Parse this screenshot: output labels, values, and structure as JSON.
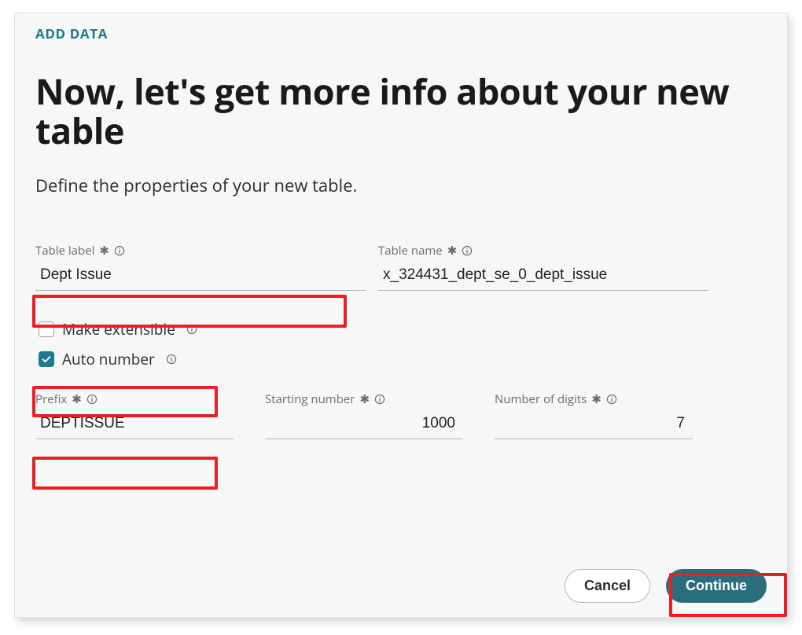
{
  "breadcrumb": "ADD DATA",
  "title": "Now, let's get more info about your new table",
  "subtitle": "Define the properties of your new table.",
  "fields": {
    "table_label": {
      "label": "Table label",
      "value": "Dept Issue"
    },
    "table_name": {
      "label": "Table name",
      "value": "x_324431_dept_se_0_dept_issue"
    },
    "make_extensible": {
      "label": "Make extensible",
      "checked": false
    },
    "auto_number": {
      "label": "Auto number",
      "checked": true
    },
    "prefix": {
      "label": "Prefix",
      "value": "DEPTISSUE"
    },
    "starting_number": {
      "label": "Starting number",
      "value": "1000"
    },
    "number_of_digits": {
      "label": "Number of digits",
      "value": "7"
    }
  },
  "buttons": {
    "cancel": "Cancel",
    "continue": "Continue"
  },
  "colors": {
    "accent": "#1f7a8c",
    "primary_btn": "#2a6e7e",
    "highlight": "#ee1c25"
  }
}
